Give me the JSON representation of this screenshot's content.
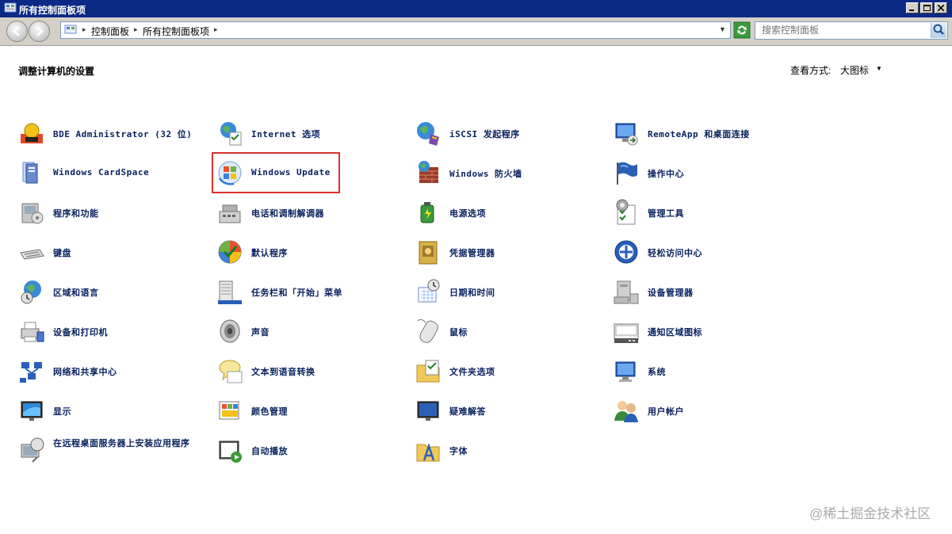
{
  "window": {
    "title": "所有控制面板项"
  },
  "address": {
    "crumbs": [
      "控制面板",
      "所有控制面板项"
    ]
  },
  "search": {
    "placeholder": "搜索控制面板"
  },
  "content": {
    "heading": "调整计算机的设置",
    "view_by_label": "查看方式:",
    "view_by_value": "大图标"
  },
  "items": [
    {
      "label": "BDE Administrator (32 位)",
      "icon": "bde-admin-icon"
    },
    {
      "label": "Internet 选项",
      "icon": "internet-options-icon"
    },
    {
      "label": "iSCSI 发起程序",
      "icon": "iscsi-initiator-icon"
    },
    {
      "label": "RemoteApp 和桌面连接",
      "icon": "remoteapp-icon"
    },
    {
      "label": "Windows CardSpace",
      "icon": "cardspace-icon"
    },
    {
      "label": "Windows Update",
      "icon": "windows-update-icon"
    },
    {
      "label": "Windows 防火墙",
      "icon": "firewall-icon"
    },
    {
      "label": "操作中心",
      "icon": "action-center-flag-icon"
    },
    {
      "label": "程序和功能",
      "icon": "programs-features-icon"
    },
    {
      "label": "电话和调制解调器",
      "icon": "phone-modem-icon"
    },
    {
      "label": "电源选项",
      "icon": "power-options-icon"
    },
    {
      "label": "管理工具",
      "icon": "admin-tools-icon"
    },
    {
      "label": "键盘",
      "icon": "keyboard-icon"
    },
    {
      "label": "默认程序",
      "icon": "default-programs-icon"
    },
    {
      "label": "凭据管理器",
      "icon": "credential-manager-icon"
    },
    {
      "label": "轻松访问中心",
      "icon": "ease-of-access-icon"
    },
    {
      "label": "区域和语言",
      "icon": "region-language-icon"
    },
    {
      "label": "任务栏和「开始」菜单",
      "icon": "taskbar-start-icon"
    },
    {
      "label": "日期和时间",
      "icon": "date-time-icon"
    },
    {
      "label": "设备管理器",
      "icon": "device-manager-icon"
    },
    {
      "label": "设备和打印机",
      "icon": "devices-printers-icon"
    },
    {
      "label": "声音",
      "icon": "sound-icon"
    },
    {
      "label": "鼠标",
      "icon": "mouse-icon"
    },
    {
      "label": "通知区域图标",
      "icon": "notification-icons-icon"
    },
    {
      "label": "网络和共享中心",
      "icon": "network-sharing-icon"
    },
    {
      "label": "文本到语音转换",
      "icon": "text-to-speech-icon"
    },
    {
      "label": "文件夹选项",
      "icon": "folder-options-icon"
    },
    {
      "label": "系统",
      "icon": "system-icon"
    },
    {
      "label": "显示",
      "icon": "display-icon"
    },
    {
      "label": "颜色管理",
      "icon": "color-management-icon"
    },
    {
      "label": "疑难解答",
      "icon": "troubleshooting-icon"
    },
    {
      "label": "用户帐户",
      "icon": "user-accounts-icon"
    },
    {
      "label": "在远程桌面服务器上安装应用程序",
      "icon": "rd-install-app-icon"
    },
    {
      "label": "自动播放",
      "icon": "autoplay-icon"
    },
    {
      "label": "字体",
      "icon": "fonts-icon"
    }
  ],
  "watermark": "@稀土掘金技术社区",
  "colors": {
    "titlebar": "#0b2a86",
    "link_text": "#08205e",
    "highlight_box": "#d9322d"
  }
}
